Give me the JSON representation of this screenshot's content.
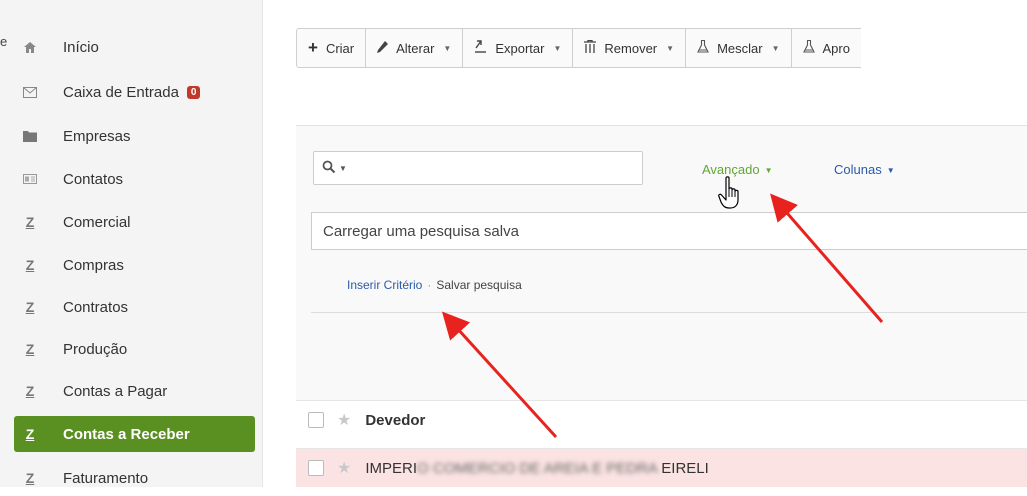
{
  "corner_text": "e",
  "sidebar": {
    "items": [
      {
        "label": "Início",
        "icon": "home-icon"
      },
      {
        "label": "Caixa de Entrada",
        "icon": "envelope-icon",
        "badge": "0"
      },
      {
        "label": "Empresas",
        "icon": "folder-icon"
      },
      {
        "label": "Contatos",
        "icon": "contact-card-icon"
      },
      {
        "label": "Comercial",
        "icon": "z-icon"
      },
      {
        "label": "Compras",
        "icon": "z-icon"
      },
      {
        "label": "Contratos",
        "icon": "z-icon"
      },
      {
        "label": "Produção",
        "icon": "z-icon"
      },
      {
        "label": "Contas a Pagar",
        "icon": "z-icon"
      },
      {
        "label": "Contas a Receber",
        "icon": "z-icon",
        "active": true
      },
      {
        "label": "Faturamento",
        "icon": "z-icon"
      }
    ],
    "active_color": "#5a8f21"
  },
  "toolbar": {
    "criar": "Criar",
    "alterar": "Alterar",
    "exportar": "Exportar",
    "remover": "Remover",
    "mesclar": "Mesclar",
    "aprovar": "Apro"
  },
  "search": {
    "query": "",
    "advanced": "Avançado",
    "columns": "Colunas",
    "saved_placeholder": "Carregar uma pesquisa salva",
    "insert_criteria": "Inserir Critério",
    "separator": "·",
    "save_search": "Salvar pesquisa"
  },
  "table": {
    "header": "Devedor",
    "rows": [
      {
        "prefix": "IMPERI",
        "redacted": "O COMERCIO DE AREIA E PEDRA ",
        "suffix": "EIRELI"
      }
    ]
  },
  "colors": {
    "accent_green": "#5fa834",
    "link_blue": "#2b5aa8",
    "annotation_red": "#e8231f",
    "row_highlight": "#fbe3e3"
  }
}
